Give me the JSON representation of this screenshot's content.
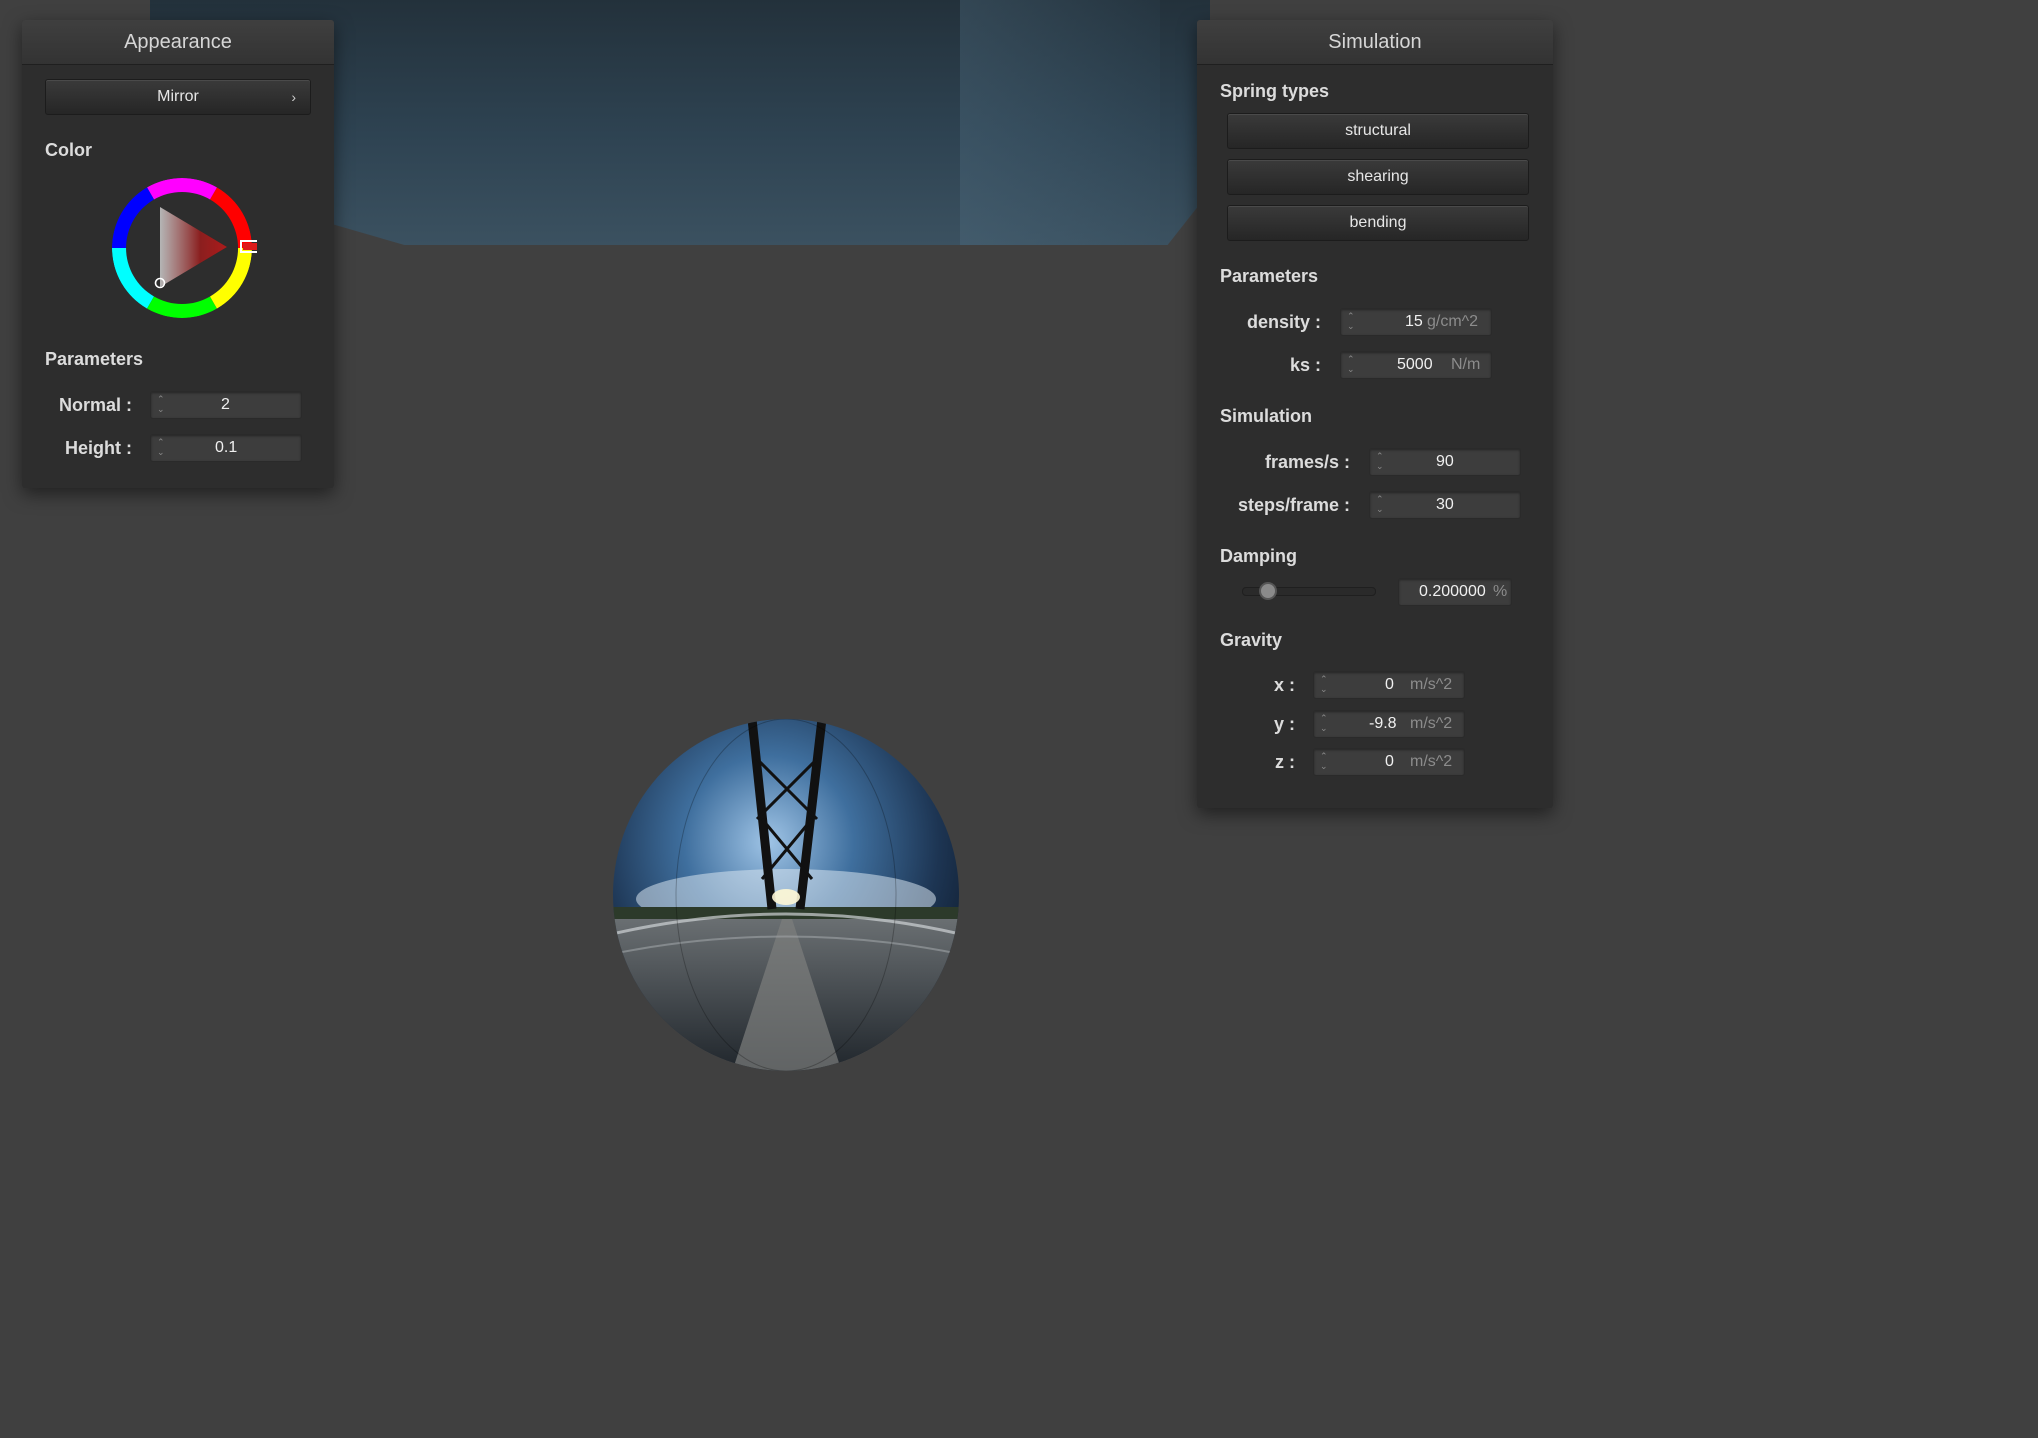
{
  "appearance": {
    "title": "Appearance",
    "shader_select": "Mirror",
    "color_label": "Color",
    "selected_color": "#dd2222",
    "parameters_label": "Parameters",
    "normal": {
      "label": "Normal :",
      "value": "2"
    },
    "height": {
      "label": "Height :",
      "value": "0.1"
    }
  },
  "simulation": {
    "title": "Simulation",
    "spring_types_label": "Spring types",
    "spring_buttons": [
      "structural",
      "shearing",
      "bending"
    ],
    "parameters_label": "Parameters",
    "density": {
      "label": "density :",
      "value": "15",
      "unit": "g/cm^2"
    },
    "ks": {
      "label": "ks :",
      "value": "5000",
      "unit": "N/m"
    },
    "simulation_label": "Simulation",
    "frames": {
      "label": "frames/s :",
      "value": "90"
    },
    "steps": {
      "label": "steps/frame :",
      "value": "30"
    },
    "damping_label": "Damping",
    "damping": {
      "value": "0.200000",
      "unit": "%",
      "slider_fraction": 0.2
    },
    "gravity_label": "Gravity",
    "gravity": [
      {
        "label": "x :",
        "value": "0",
        "unit": "m/s^2"
      },
      {
        "label": "y :",
        "value": "-9.8",
        "unit": "m/s^2"
      },
      {
        "label": "z :",
        "value": "0",
        "unit": "m/s^2"
      }
    ]
  },
  "scene": {
    "object": "mirror-sphere"
  }
}
